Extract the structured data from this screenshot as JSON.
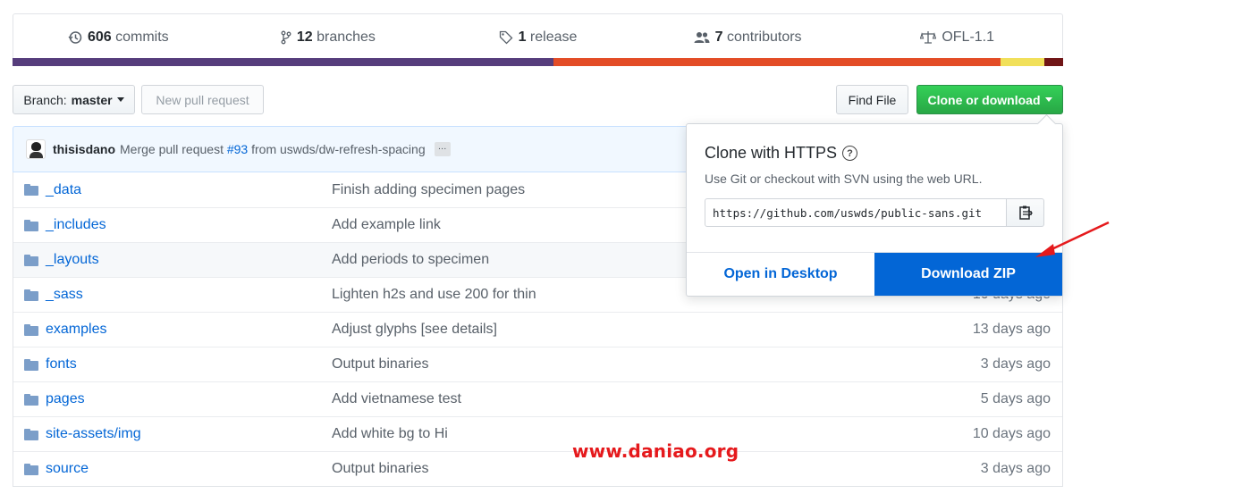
{
  "summary": {
    "items": [
      {
        "icon": "history-icon",
        "count": "606",
        "label": "commits"
      },
      {
        "icon": "branch-icon",
        "count": "12",
        "label": "branches"
      },
      {
        "icon": "tag-icon",
        "count": "1",
        "label": "release"
      },
      {
        "icon": "people-icon",
        "count": "7",
        "label": "contributors"
      },
      {
        "icon": "law-icon",
        "count": "",
        "label": "OFL-1.1"
      }
    ],
    "language_colors": [
      "#563d7c",
      "#e34c26",
      "#f1e05a",
      "#701516"
    ],
    "language_fractions": [
      0.515,
      0.425,
      0.042,
      0.018
    ]
  },
  "toolbar": {
    "branch_prefix": "Branch:",
    "branch_name": "master",
    "new_pull_request": "New pull request",
    "find_file": "Find File",
    "clone_or_download": "Clone or download"
  },
  "commit": {
    "author": "thisisdano",
    "message_prefix": "Merge pull request",
    "pr_link": "#93",
    "message_suffix": "from uswds/dw-refresh-spacing",
    "ellipsis": "…"
  },
  "files": [
    {
      "name": "_data",
      "message": "Finish adding specimen pages",
      "age": ""
    },
    {
      "name": "_includes",
      "message": "Add example link",
      "age": ""
    },
    {
      "name": "_layouts",
      "message": "Add periods to specimen",
      "age": ""
    },
    {
      "name": "_sass",
      "message": "Lighten h2s and use 200 for thin",
      "age": "10 days ago"
    },
    {
      "name": "examples",
      "message": "Adjust glyphs [see details]",
      "age": "13 days ago"
    },
    {
      "name": "fonts",
      "message": "Output binaries",
      "age": "3 days ago"
    },
    {
      "name": "pages",
      "message": "Add vietnamese test",
      "age": "5 days ago"
    },
    {
      "name": "site-assets/img",
      "message": "Add white bg to Hi",
      "age": "10 days ago"
    },
    {
      "name": "source",
      "message": "Output binaries",
      "age": "3 days ago"
    }
  ],
  "clone_popup": {
    "title": "Clone with HTTPS",
    "help": "?",
    "description": "Use Git or checkout with SVN using the web URL.",
    "url": "https://github.com/uswds/public-sans.git",
    "open_in_desktop": "Open in Desktop",
    "download_zip": "Download ZIP"
  },
  "watermark": "www.daniao.org",
  "colors": {
    "accent_blue": "#0366d6",
    "green": "#28a745",
    "annotation_red": "#e5191c"
  }
}
